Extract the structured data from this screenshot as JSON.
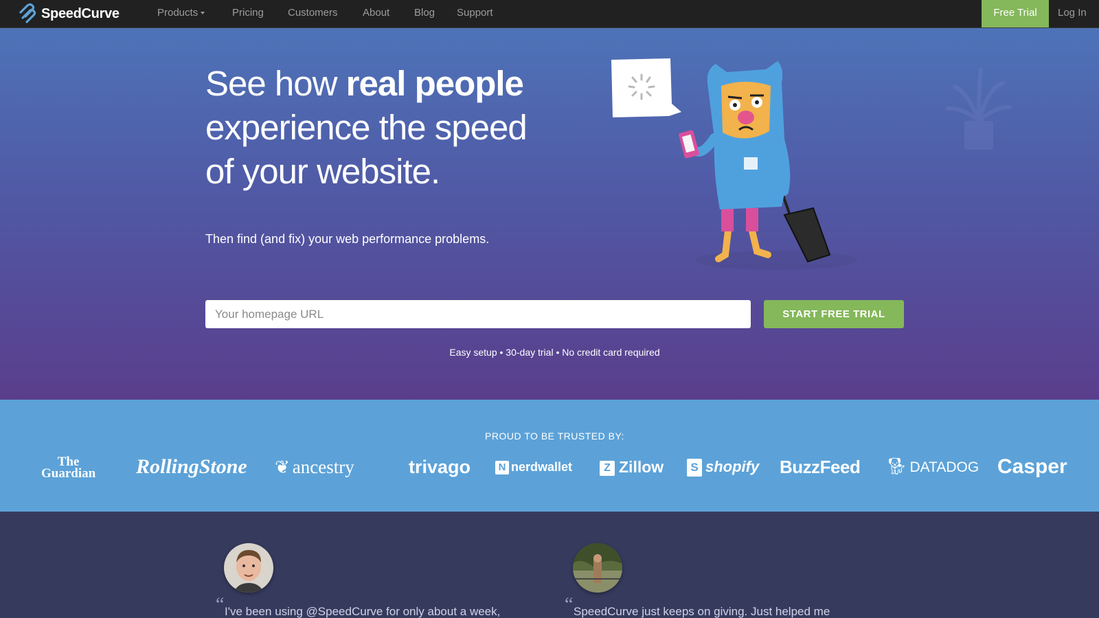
{
  "brand": {
    "name": "SpeedCurve",
    "logo_icon": "speedcurve-logo-icon"
  },
  "nav": {
    "items": [
      {
        "label": "Products",
        "has_dropdown": true
      },
      {
        "label": "Pricing"
      },
      {
        "label": "Customers"
      },
      {
        "label": "About"
      },
      {
        "label": "Blog"
      },
      {
        "label": "Support"
      }
    ],
    "free_trial": "Free Trial",
    "login": "Log In"
  },
  "hero": {
    "headline_pre": "See how ",
    "headline_bold": "real people",
    "headline_line2": "experience the speed",
    "headline_line3": "of your website.",
    "subhead": "Then find (and fix) your web performance problems.",
    "url_placeholder": "Your homepage URL",
    "url_value": "",
    "cta": "START FREE TRIAL",
    "fine_print": "Easy setup • 30-day trial • No credit card required",
    "illustration": "waiting-traveler-character-illustration"
  },
  "trusted": {
    "title": "PROUD TO BE TRUSTED BY:",
    "logos": [
      "The Guardian",
      "RollingStone",
      "ancestry",
      "trivago",
      "nerdwallet",
      "Zillow",
      "shopify",
      "BuzzFeed",
      "DATADOG",
      "Casper"
    ],
    "guardian_line1": "The",
    "guardian_line2": "Guardian",
    "rolling": "RollingStone",
    "ancestry": "ancestry",
    "trivago": "trivago",
    "nerdwallet": "nerdwallet",
    "zillow": "Zillow",
    "shopify": "shopify",
    "buzzfeed": "BuzzFeed",
    "datadog": "DATADOG",
    "casper": "Casper"
  },
  "testimonials": [
    {
      "quote": "I've been using @SpeedCurve for only about a week,",
      "avatar": "avatar-photo"
    },
    {
      "quote": "SpeedCurve just keeps on giving. Just helped me",
      "avatar": "avatar-photo"
    }
  ],
  "colors": {
    "nav_bg": "#212121",
    "accent_green": "#84b85a",
    "hero_top": "#4e73b8",
    "hero_bottom": "#5a3e8c",
    "trusted_bg": "#5ca2d8",
    "testimonial_bg": "#363b5e"
  }
}
